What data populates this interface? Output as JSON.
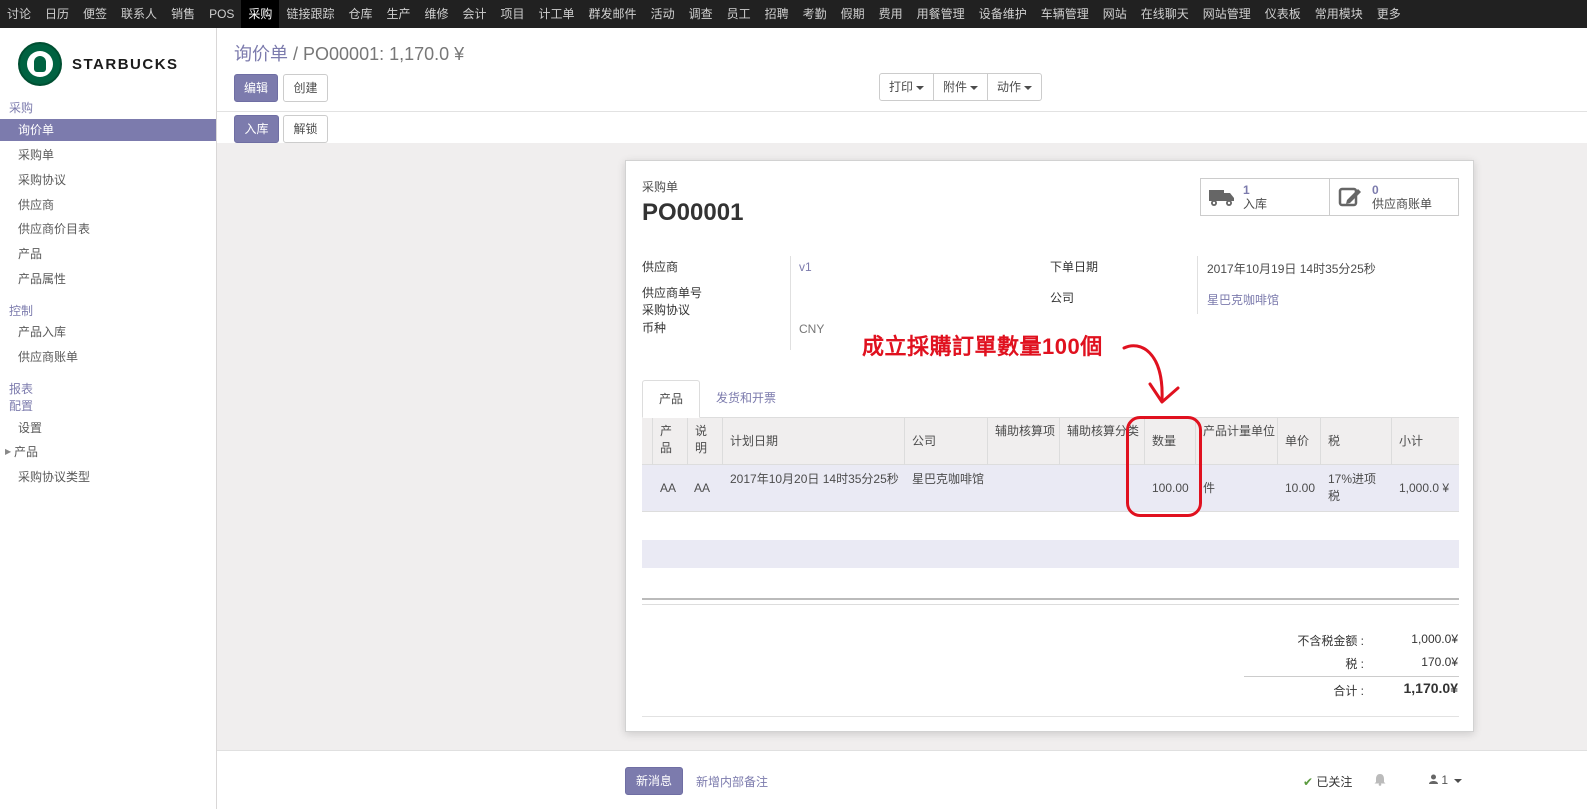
{
  "topmenu": [
    "讨论",
    "日历",
    "便签",
    "联系人",
    "销售",
    "POS",
    "采购",
    "链接跟踪",
    "仓库",
    "生产",
    "维修",
    "会计",
    "项目",
    "计工单",
    "群发邮件",
    "活动",
    "调查",
    "员工",
    "招聘",
    "考勤",
    "假期",
    "费用",
    "用餐管理",
    "设备维护",
    "车辆管理",
    "网站",
    "在线聊天",
    "网站管理",
    "仪表板",
    "常用模块",
    "更多"
  ],
  "topmenu_active": "采购",
  "logo_text": "STARBUCKS",
  "sidebar": {
    "sec_purchase": "采购",
    "rfq": "询价单",
    "po": "采购单",
    "agreement": "采购协议",
    "vendor": "供应商",
    "pricelist": "供应商价目表",
    "product": "产品",
    "attr": "产品属性",
    "sec_control": "控制",
    "receipt": "产品入库",
    "bill": "供应商账单",
    "sec_report": "报表",
    "sec_config": "配置",
    "settings": "设置",
    "cfg_product": "产品",
    "agreement_type": "采购协议类型"
  },
  "breadcrumb": {
    "parent": "询价单",
    "current": "PO00001: 1,170.0 ¥"
  },
  "buttons": {
    "edit": "编辑",
    "create": "创建",
    "print": "打印",
    "attach": "附件",
    "action": "动作",
    "receive": "入库",
    "unlock": "解锁"
  },
  "form": {
    "doc_type": "采购单",
    "name": "PO00001",
    "smart": {
      "receipts_count": "1",
      "receipts_label": "入库",
      "bills_count": "0",
      "bills_label": "供应商账单"
    },
    "vendor_label": "供应商",
    "vendor": "v1",
    "vendor_ref_label": "供应商单号",
    "agreement_label": "采购协议",
    "currency_label": "币种",
    "currency": "CNY",
    "order_date_label": "下单日期",
    "order_date": "2017年10月19日 14时35分25秒",
    "company_label": "公司",
    "company": "星巴克咖啡馆",
    "tab_products": "产品",
    "tab_delivery": "发货和开票"
  },
  "lines": {
    "headers": [
      "产品",
      "说明",
      "计划日期",
      "公司",
      "辅助核算项",
      "辅助核算分类",
      "数量",
      "产品计量单位",
      "单价",
      "税",
      "小计"
    ],
    "row": {
      "product": "AA",
      "desc": "AA",
      "date": "2017年10月20日 14时35分25秒",
      "company": "星巴克咖啡馆",
      "qty": "100.00",
      "uom": "件",
      "price": "10.00",
      "tax": "17%进项税",
      "subtotal": "1,000.0 ¥"
    }
  },
  "totals": {
    "untaxed_label": "不含税金额 :",
    "untaxed": "1,000.0¥",
    "tax_label": "税 :",
    "tax": "170.0¥",
    "total_label": "合计 :",
    "total": "1,170.0¥"
  },
  "chatter": {
    "new_message": "新消息",
    "log_note": "新增内部备注",
    "following": "已关注",
    "followers": "1"
  },
  "annotation": "成立採購訂單數量100個",
  "colors": {
    "accent": "#7c7bad",
    "annotation": "#e0111f",
    "topbar": "#212121"
  }
}
